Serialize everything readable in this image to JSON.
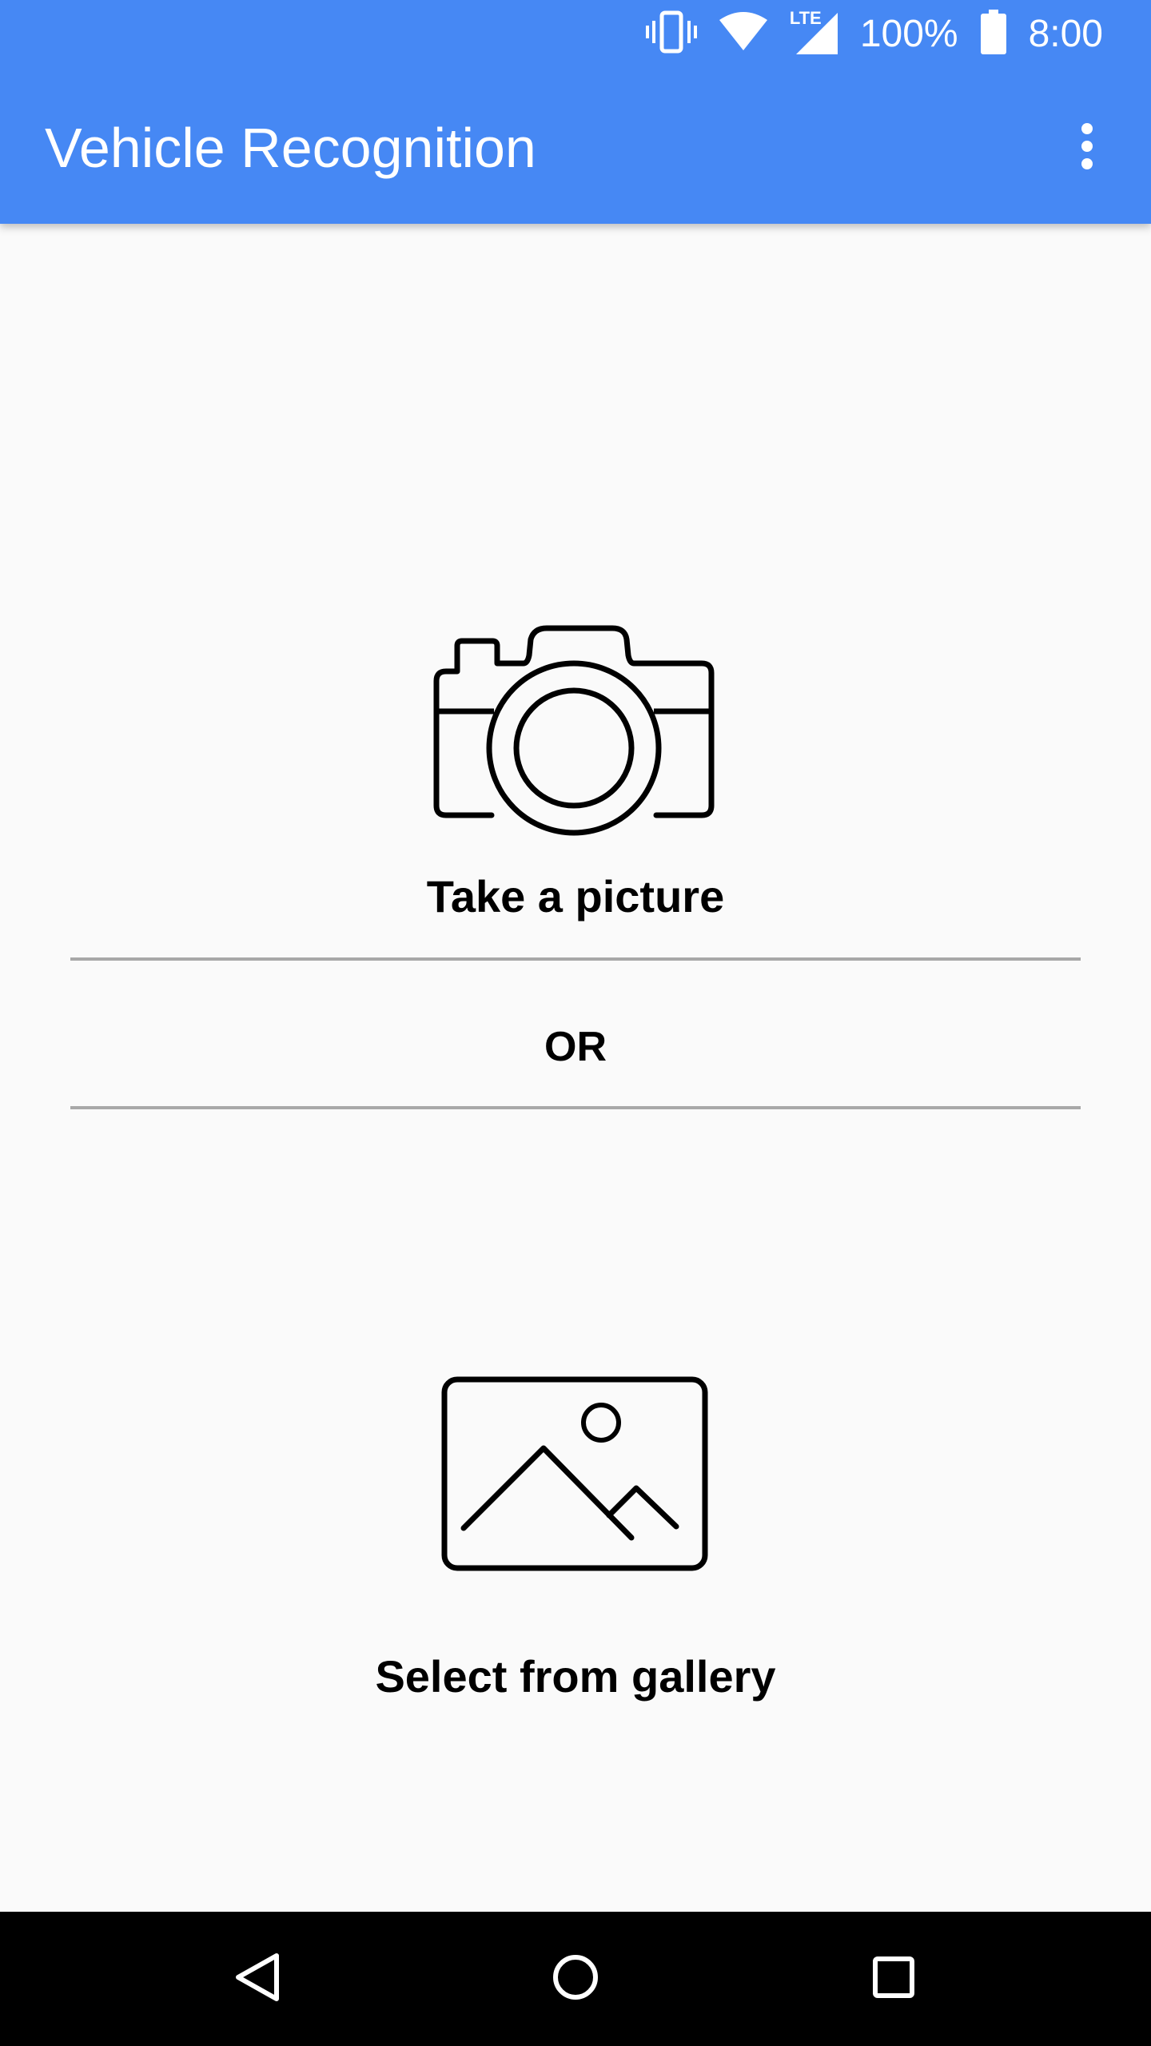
{
  "status_bar": {
    "battery_percent": "100%",
    "time": "8:00",
    "network_label": "LTE",
    "icons": [
      "vibrate-icon",
      "wifi-icon",
      "lte-signal-icon",
      "battery-icon"
    ]
  },
  "app_bar": {
    "title": "Vehicle Recognition",
    "overflow_icon": "more-vert-icon"
  },
  "main": {
    "camera_option": {
      "icon": "camera-icon",
      "label": "Take a picture"
    },
    "separator_label": "OR",
    "gallery_option": {
      "icon": "image-icon",
      "label": "Select from gallery"
    }
  },
  "nav_bar": {
    "icons": [
      "back-icon",
      "home-icon",
      "recents-icon"
    ]
  },
  "colors": {
    "primary": "#4688f4",
    "background": "#fafafa",
    "divider": "#a8a8a8",
    "navbar": "#000000"
  }
}
